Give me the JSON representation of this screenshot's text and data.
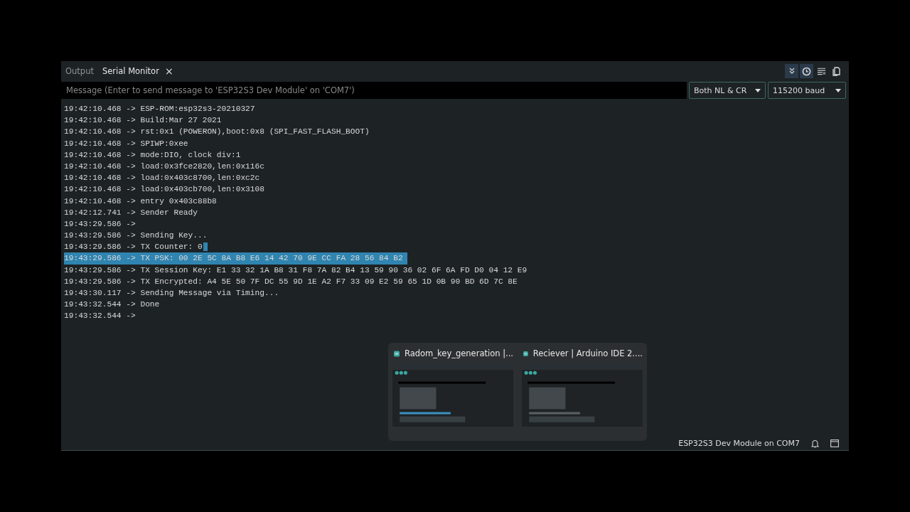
{
  "tabs": [
    {
      "label": "Output",
      "selected": false
    },
    {
      "label": "Serial Monitor",
      "selected": true,
      "close_glyph": "×"
    }
  ],
  "toolbar": [
    {
      "kind": "autoscroll",
      "on": true
    },
    {
      "kind": "timestamp",
      "on": true
    },
    {
      "kind": "clear",
      "on": false
    },
    {
      "kind": "copy",
      "on": false
    }
  ],
  "message": {
    "placeholder": "Message (Enter to send message to 'ESP32S3 Dev Module' on 'COM7')"
  },
  "line_ending": "Both NL & CR",
  "baud": "115200 baud",
  "lines": [
    {
      "text": "19:42:10.468 -> ESP-ROM:esp32s3-20210327",
      "selected": false,
      "caret": false
    },
    {
      "text": "19:42:10.468 -> Build:Mar 27 2021",
      "selected": false,
      "caret": false
    },
    {
      "text": "19:42:10.468 -> rst:0x1 (POWERON),boot:0x8 (SPI_FAST_FLASH_BOOT)",
      "selected": false,
      "caret": false
    },
    {
      "text": "19:42:10.468 -> SPIWP:0xee",
      "selected": false,
      "caret": false
    },
    {
      "text": "19:42:10.468 -> mode:DIO, clock div:1",
      "selected": false,
      "caret": false
    },
    {
      "text": "19:42:10.468 -> load:0x3fce2820,len:0x116c",
      "selected": false,
      "caret": false
    },
    {
      "text": "19:42:10.468 -> load:0x403c8700,len:0xc2c",
      "selected": false,
      "caret": false
    },
    {
      "text": "19:42:10.468 -> load:0x403cb700,len:0x3108",
      "selected": false,
      "caret": false
    },
    {
      "text": "19:42:10.468 -> entry 0x403c88b8",
      "selected": false,
      "caret": false
    },
    {
      "text": "19:42:12.741 -> Sender Ready",
      "selected": false,
      "caret": false
    },
    {
      "text": "19:43:29.586 ->",
      "selected": false,
      "caret": false
    },
    {
      "text": "19:43:29.586 -> Sending Key...",
      "selected": false,
      "caret": false
    },
    {
      "text": "19:43:29.586 -> TX Counter: 0",
      "selected": false,
      "caret": true
    },
    {
      "text": "19:43:29.586 -> TX PSK: 00 2E 5C 8A B8 E6 14 42 70 9E CC FA 28 56 84 B2",
      "selected": true,
      "caret": false
    },
    {
      "text": "19:43:29.586 -> TX Session Key: E1 33 32 1A B8 31 F8 7A 82 B4 13 59 90 36 02 6F 6A FD D0 04 12 E9",
      "selected": false,
      "caret": false
    },
    {
      "text": "19:43:29.586 -> TX Encrypted: A4 5E 50 7F DC 55 9D 1E A2 F7 33 09 E2 59 65 1D 0B 90 BD 6D 7C 8E",
      "selected": false,
      "caret": false
    },
    {
      "text": "19:43:30.117 -> Sending Message via Timing...",
      "selected": false,
      "caret": false
    },
    {
      "text": "19:43:32.544 -> Done",
      "selected": false,
      "caret": false
    },
    {
      "text": "19:43:32.544 ->",
      "selected": false,
      "caret": false
    }
  ],
  "status_bar": {
    "board": "ESP32S3 Dev Module on COM7"
  },
  "taskbar_previews": [
    {
      "title": "Radom_key_generation |..."
    },
    {
      "title": "Reciever | Arduino IDE 2...."
    }
  ]
}
